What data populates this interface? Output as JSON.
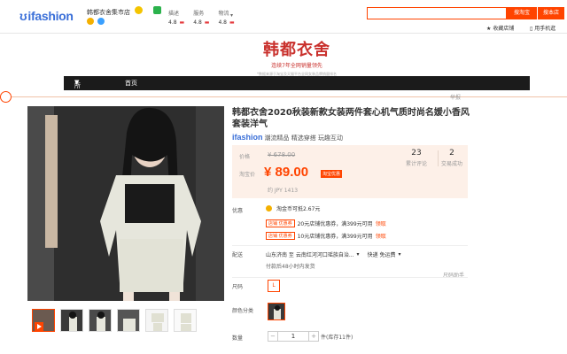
{
  "header": {
    "logo_text": "ifashion",
    "shop_name": "韩都衣舍集市店",
    "ratings": [
      {
        "label": "描述",
        "value": "4.8"
      },
      {
        "label": "服务",
        "value": "4.8"
      },
      {
        "label": "物流",
        "value": "4.8"
      }
    ],
    "search_placeholder": "",
    "search_button": "搜淘宝",
    "search_shop_button": "搜本店",
    "collect_label": "收藏店铺",
    "phone_label": "用手机逛"
  },
  "banner": {
    "brand": "韩都衣舍",
    "tagline": "连续7年全网销量领先",
    "sub": "*数据来源于淘宝及天猫平台全网女装品牌销量排名"
  },
  "nav": {
    "all_categories": "所有分类",
    "home": "首页"
  },
  "report_label": "举报",
  "product": {
    "title": "韩都衣舍2020秋装新款女装两件套心机气质时尚名媛小香风套装洋气",
    "brand_logo": "ifashion",
    "brand_desc": "潮流精品 精选穿搭 玩趣互动",
    "price_label": "价格",
    "original_price": "¥ 678.00",
    "tb_price_label": "淘宝价",
    "price": "¥ 89.00",
    "price_tag": "淘宝优惠",
    "jpy": "约 JPY 1413",
    "review_count": "23",
    "review_label": "累计评论",
    "sales_count": "2",
    "sales_label": "交易成功"
  },
  "promotions": {
    "label": "优惠",
    "coin_text": "淘金币可抵2.67元",
    "coupons": [
      {
        "tag": "店铺 优惠券",
        "text": "20元店铺优惠券，满399元可用",
        "get": "领取"
      },
      {
        "tag": "店铺 优惠券",
        "text": "10元店铺优惠券，满399元可用",
        "get": "领取"
      }
    ]
  },
  "shipping": {
    "label": "配送",
    "from": "山东济南 至 云南红河河口瑶族自治...",
    "express": "快递 免运费",
    "note": "付款后48小时内发货"
  },
  "options": {
    "size_guide": "尺码助手",
    "size_label": "尺码",
    "size_value": "L",
    "color_label": "颜色分类",
    "qty_label": "数量",
    "qty_value": "1",
    "minus": "−",
    "plus": "+",
    "stock": "件(库存11件)"
  },
  "colors": {
    "accent": "#ff4400",
    "brand_red": "#c9302c",
    "logo_blue": "#3a6fd8",
    "nav_bg": "#1b1b1b"
  }
}
